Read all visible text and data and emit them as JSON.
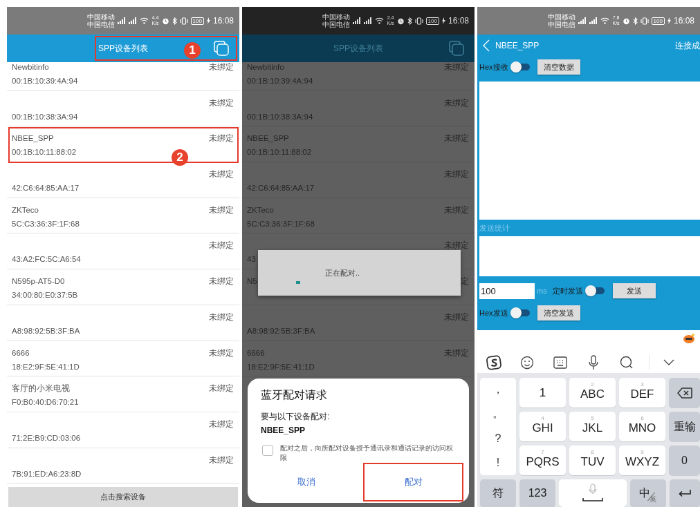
{
  "panels": [
    {
      "kind": "device_list",
      "status_bar": {
        "carriers": [
          "中国移动",
          "中国电信"
        ],
        "speed": "4.4",
        "speed_unit": "K/s",
        "battery": "100",
        "time": "16:08"
      },
      "app_bar": {
        "title": "SPP设备列表",
        "badge": "1"
      },
      "devices": [
        {
          "name": "Newbitinfo",
          "address": "00:1B:10:39:4A:94",
          "status": "未绑定",
          "highlighted": false
        },
        {
          "address": "00:1B:10:38:3A:94",
          "status": "未绑定",
          "highlighted": false
        },
        {
          "name": "NBEE_SPP",
          "address": "00:1B:10:11:88:02",
          "status": "未绑定",
          "highlighted": true,
          "badge": "2"
        },
        {
          "address": "42:C6:64:85:AA:17",
          "status": "未绑定",
          "highlighted": false
        },
        {
          "name": "ZKTeco",
          "address": "5C:C3:36:3F:1F:68",
          "status": "未绑定",
          "highlighted": false
        },
        {
          "address": "43:A2:FC:5C:A6:54",
          "status": "未绑定",
          "highlighted": false
        },
        {
          "name": "N595p-AT5-D0",
          "address": "34:00:80:E0:37:5B",
          "status": "未绑定",
          "highlighted": false
        },
        {
          "address": "A8:98:92:5B:3F:BA",
          "status": "未绑定",
          "highlighted": false
        },
        {
          "name": "6666",
          "address": "18:E2:9F:5E:41:1D",
          "status": "未绑定",
          "highlighted": false
        },
        {
          "name": "客厅的小米电视",
          "address": "F0:B0:40:D6:70:21",
          "status": "未绑定",
          "highlighted": false
        },
        {
          "address": "71:2E:B9:CD:03:06",
          "status": "未绑定",
          "highlighted": false
        },
        {
          "address": "7B:91:ED:A6:23:8D",
          "status": "未绑定",
          "highlighted": false
        }
      ],
      "search_button": "点击搜索设备"
    },
    {
      "kind": "pairing",
      "status_bar": {
        "carriers": [
          "中国移动",
          "中国电信"
        ],
        "speed": "2.4",
        "speed_unit": "K/s",
        "battery": "100",
        "time": "16:08"
      },
      "app_bar": {
        "title": "SPP设备列表"
      },
      "devices": [
        {
          "name": "Newbitinfo",
          "address": "00:1B:10:39:4A:94",
          "status": "未绑定",
          "highlighted": false
        },
        {
          "address": "00:1B:10:38:3A:94",
          "status": "未绑定",
          "highlighted": false
        },
        {
          "name": "NBEE_SPP",
          "address": "00:1B:10:11:88:02",
          "status": "未绑定",
          "highlighted": false
        },
        {
          "address": "42:C6:64:85:AA:17",
          "status": "未绑定",
          "highlighted": false
        },
        {
          "name": "ZKTeco",
          "address": "5C:C3:36:3F:1F:68",
          "status": "未绑定",
          "highlighted": false
        },
        {
          "address": "43",
          "status": "未绑定",
          "highlighted": false
        },
        {
          "name": "N5",
          "status": "定",
          "highlighted": false
        },
        {
          "address": "A8:98:92:5B:3F:BA",
          "status": "未绑定",
          "highlighted": false
        },
        {
          "name": "6666",
          "address": "18:E2:9F:5E:41:1D",
          "status": "未绑定",
          "highlighted": false
        }
      ],
      "toast": {
        "text": "正在配对.."
      },
      "dialog": {
        "title": "蓝牙配对请求",
        "message": "要与以下设备配对:",
        "device": "NBEE_SPP",
        "checkbox": {
          "label": "配对之后，向所配对设备授予通讯录和通话记录的访问权限",
          "checked": false
        },
        "buttons": [
          {
            "label": "取消",
            "highlighted": false
          },
          {
            "label": "配对",
            "highlighted": true
          }
        ]
      }
    },
    {
      "kind": "terminal",
      "status_bar": {
        "carriers": [
          "中国移动",
          "中国电信"
        ],
        "speed": "7.8",
        "speed_unit": "K/s",
        "battery": "100",
        "time": "16:08"
      },
      "app_bar": {
        "title": "NBEE_SPP",
        "status": "连接成"
      },
      "receive": {
        "hex_label": "Hex接收",
        "hex_on": false,
        "clear_button": "清空数据"
      },
      "stats_label": "发送统计",
      "send": {
        "interval": "100",
        "unit": "ms",
        "timer_label": "定时发送",
        "timer_on": false,
        "send_button": "发送",
        "hex_label": "Hex发送",
        "hex_on": false,
        "clear_button": "清空发送"
      },
      "keyboard": {
        "punctuation": [
          "，",
          "。",
          "?",
          "!"
        ],
        "keys": [
          {
            "kind": "char",
            "label": "1"
          },
          {
            "kind": "char",
            "label": "ABC",
            "hint": "2"
          },
          {
            "kind": "char",
            "label": "DEF",
            "hint": "3"
          },
          {
            "kind": "backspace"
          },
          {
            "kind": "char",
            "label": "GHI",
            "hint": "4"
          },
          {
            "kind": "char",
            "label": "JKL",
            "hint": "5"
          },
          {
            "kind": "char",
            "label": "MNO",
            "hint": "6"
          },
          {
            "kind": "function",
            "label": "重输"
          },
          {
            "kind": "char",
            "label": "PQRS",
            "hint": "7"
          },
          {
            "kind": "char",
            "label": "TUV",
            "hint": "8"
          },
          {
            "kind": "char",
            "label": "WXYZ",
            "hint": "9"
          },
          {
            "kind": "function",
            "label": "0"
          }
        ],
        "bottom": [
          {
            "kind": "function",
            "label": "符"
          },
          {
            "kind": "function",
            "label": "123"
          },
          {
            "kind": "space"
          },
          {
            "kind": "lang",
            "label": "中",
            "sub": "英"
          },
          {
            "kind": "enter"
          }
        ]
      }
    }
  ]
}
